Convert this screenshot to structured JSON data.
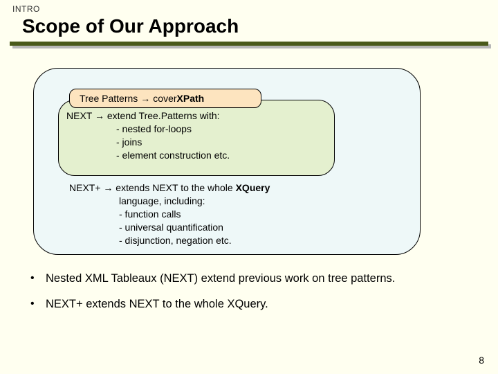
{
  "kicker": "INTRO",
  "title": "Scope of Our Approach",
  "inner": {
    "lhs": "Tree Patterns",
    "arrow": "→",
    "rhs_pre": "cover ",
    "rhs_bold": "XPath"
  },
  "mid": {
    "hdr_pre": "NEXT ",
    "arrow": "→",
    "hdr_post": "  extend Tree.Patterns  with:",
    "items": [
      "-  nested for-loops",
      "-  joins",
      "-  element construction etc."
    ]
  },
  "outer": {
    "hdr_pre": "NEXT+ ",
    "arrow": "→",
    "hdr_mid": " extends NEXT to the whole ",
    "hdr_bold": "XQuery",
    "hdr_post2": "language, including:",
    "items": [
      "-  function calls",
      "-  universal quantification",
      "-  disjunction, negation etc."
    ]
  },
  "bullets": [
    "Nested XML Tableaux (NEXT) extend previous work on tree patterns.",
    "NEXT+ extends NEXT to the whole XQuery."
  ],
  "page_number": "8"
}
